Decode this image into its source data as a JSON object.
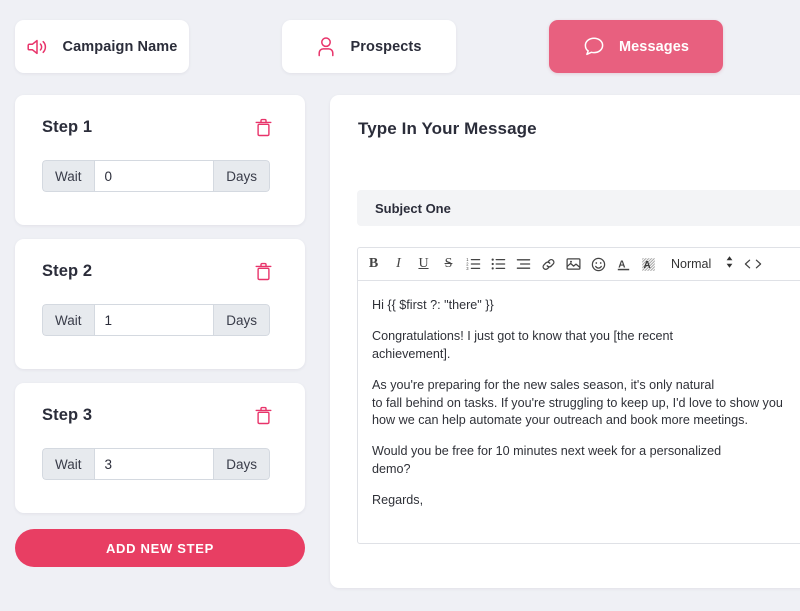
{
  "theme": {
    "background": "#eff0f5",
    "accent_pink": "#e83e63",
    "tab_active_pink": "#e8607f",
    "text_dark": "#2b2d3a",
    "card_white": "#ffffff"
  },
  "tabs": [
    {
      "id": "campaign",
      "label": "Campaign Name",
      "icon": "megaphone-icon",
      "active": false
    },
    {
      "id": "prospects",
      "label": "Prospects",
      "icon": "user-icon",
      "active": false
    },
    {
      "id": "messages",
      "label": "Messages",
      "icon": "chat-bubble-icon",
      "active": true
    }
  ],
  "sequence": {
    "steps": [
      {
        "title": "Step 1",
        "wait_label": "Wait",
        "wait_value": "0",
        "unit_label": "Days",
        "delete_icon": "trash-icon"
      },
      {
        "title": "Step 2",
        "wait_label": "Wait",
        "wait_value": "1",
        "unit_label": "Days",
        "delete_icon": "trash-icon"
      },
      {
        "title": "Step 3",
        "wait_label": "Wait",
        "wait_value": "3",
        "unit_label": "Days",
        "delete_icon": "trash-icon"
      }
    ],
    "add_step_label": "ADD NEW STEP"
  },
  "message_panel": {
    "title": "Type In Your Message",
    "subject": {
      "value": "Subject One",
      "placeholder": "Subject One"
    },
    "toolbar": {
      "buttons": [
        {
          "name": "bold-icon",
          "glyph": "B"
        },
        {
          "name": "italic-icon",
          "glyph": "I"
        },
        {
          "name": "underline-icon",
          "glyph": "U"
        },
        {
          "name": "strikethrough-icon",
          "glyph": "S"
        },
        {
          "name": "ordered-list-icon",
          "glyph": ""
        },
        {
          "name": "bullet-list-icon",
          "glyph": ""
        },
        {
          "name": "align-icon",
          "glyph": ""
        },
        {
          "name": "link-icon",
          "glyph": ""
        },
        {
          "name": "image-icon",
          "glyph": ""
        },
        {
          "name": "emoji-icon",
          "glyph": ""
        },
        {
          "name": "font-color-icon",
          "glyph": "A"
        },
        {
          "name": "highlight-icon",
          "glyph": "A"
        }
      ],
      "format_select": {
        "value": "Normal",
        "chevron_icon": "updown-arrows-icon"
      },
      "code_icon": "code-brackets-icon"
    },
    "body": {
      "paragraphs": [
        "Hi {{ $first ?: \"there\" }}",
        "Congratulations! I just got to know that you [the recent\nachievement].",
        "As you're preparing for the new sales season, it's only natural\nto fall behind on tasks. If you're struggling to keep up, I'd love to show you\nhow we can help automate your outreach and book more meetings.",
        "Would you be free for 10 minutes next week for a personalized\ndemo?",
        "Regards,"
      ]
    }
  }
}
